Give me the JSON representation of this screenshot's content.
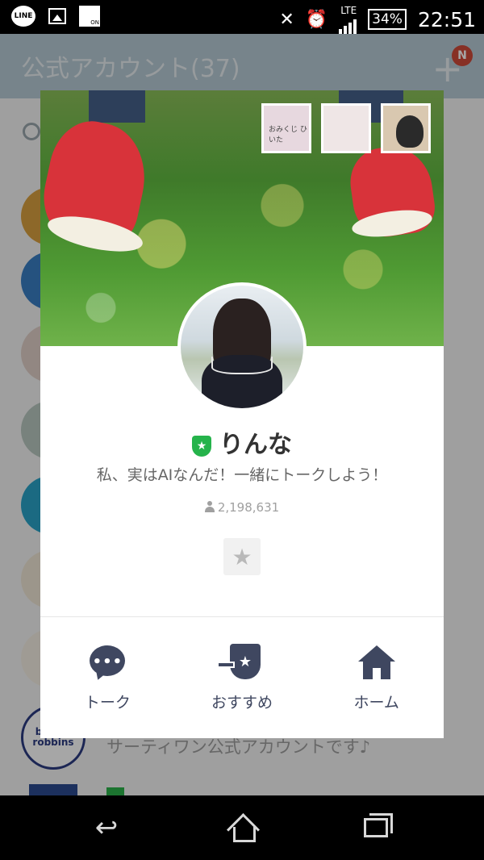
{
  "status_bar": {
    "line_label": "LINE",
    "nfc_label": "ON",
    "network": "LTE",
    "battery": "34%",
    "time": "22:51"
  },
  "background_app": {
    "title": "公式アカウント(37)",
    "badge": "N",
    "row_text": "サーティワン公式アカウントです♪",
    "logo_text": "baskin robbins"
  },
  "profile": {
    "cover_thumb_1": "おみくじ ひいた",
    "name": "りんな",
    "status_message": "私、実はAIなんだ！一緒にトークしよう！",
    "followers": "2,198,631",
    "actions": [
      {
        "label": "トーク",
        "icon": "talk-icon"
      },
      {
        "label": "おすすめ",
        "icon": "recommend-icon"
      },
      {
        "label": "ホーム",
        "icon": "home-icon"
      }
    ]
  },
  "nav": {
    "back_icon": "back-icon",
    "home_icon": "home-outline-icon",
    "recent_icon": "recent-apps-icon"
  }
}
